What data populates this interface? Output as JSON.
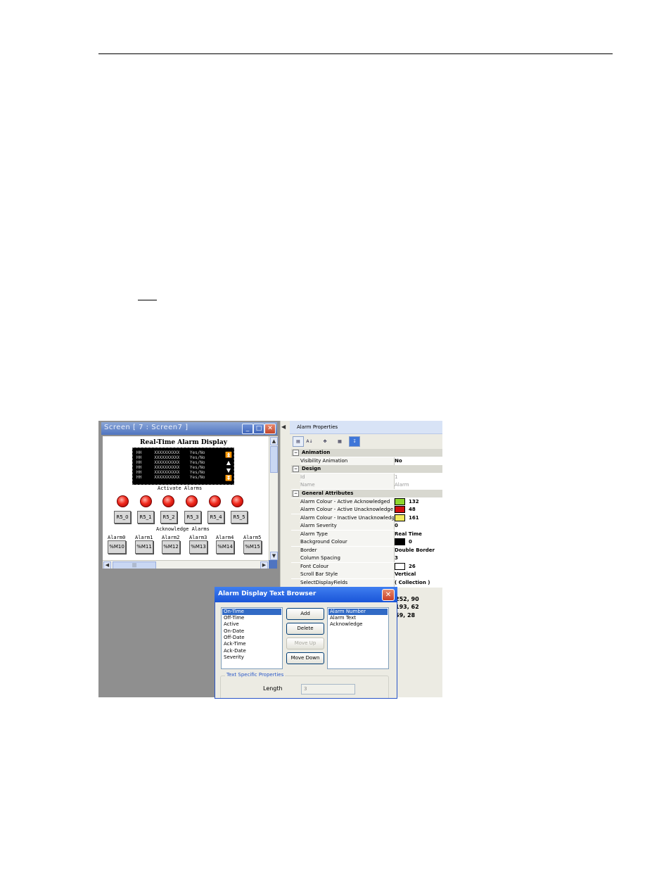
{
  "screen_window": {
    "title": "Screen  [ 7  :  Screen7 ]",
    "minimize": "_",
    "maximize": "□",
    "close": "✕",
    "display_title": "Real-Time Alarm Display",
    "alarm_rows": [
      "HH     XXXXXXXXXX    Yes/No",
      "HH     XXXXXXXXXX    Yes/No",
      "HH     XXXXXXXXXX    Yes/No",
      "HH     XXXXXXXXXX    Yes/No",
      "HH     XXXXXXXXXX    Yes/No",
      "HH     XXXXXXXXXX    Yes/No"
    ],
    "activate_label": "Activate Alarms",
    "reset_buttons": [
      "R5_0",
      "R5_1",
      "R5_2",
      "R5_3",
      "R5_4",
      "R5_5"
    ],
    "acknowledge_label": "Acknowledge Alarms",
    "alarm_labels": [
      "Alarm0",
      "Alarm1",
      "Alarm2",
      "Alarm3",
      "Alarm4",
      "Alarm5"
    ],
    "memory_buttons": [
      "%M10",
      "%M11",
      "%M12",
      "%M13",
      "%M14",
      "%M15"
    ]
  },
  "properties": {
    "title": "Alarm Properties",
    "animation": {
      "category": "Animation",
      "visibility_name": "Visibility Animation",
      "visibility_value": "No"
    },
    "design": {
      "category": "Design",
      "id_name": "Id",
      "id_value": "1",
      "name_name": "Name",
      "name_value": "Alarm"
    },
    "general": {
      "category": "General Attributes",
      "ack_name": "Alarm Colour - Active Acknowledged",
      "ack_value": "132",
      "ack_color": "#8fd62e",
      "unack_name": "Alarm Colour - Active Unacknowledge",
      "unack_value": "48",
      "unack_color": "#d01010",
      "inactive_name": "Alarm Colour - Inactive Unacknowledg",
      "inactive_value": "161",
      "inactive_color": "#f2ea5c",
      "severity_name": "Alarm Severity",
      "severity_value": "0",
      "type_name": "Alarm Type",
      "type_value": "Real Time",
      "bg_name": "Background Colour",
      "bg_value": "0",
      "bg_color": "#000000",
      "border_name": "Border",
      "border_value": "Double Border",
      "spacing_name": "Column Spacing",
      "spacing_value": "3",
      "font_name": "Font Colour",
      "font_value": "26",
      "font_color": "#ffffff",
      "scroll_name": "Scroll Bar Style",
      "scroll_value": "Vertical",
      "fields_name": "SelectDisplayFields",
      "fields_value": "( Collection )"
    },
    "extra_values": [
      "252, 90",
      "193, 62",
      "59, 28"
    ]
  },
  "dialog": {
    "title": "Alarm Display Text Browser",
    "close": "✕",
    "available": [
      "On-Time",
      "Off-Time",
      "Active",
      "On-Date",
      "Off-Date",
      "Ack-Time",
      "Ack-Date",
      "Severity"
    ],
    "selected": [
      "Alarm Number",
      "Alarm Text",
      "Acknowledge"
    ],
    "add": "Add",
    "delete": "Delete",
    "move_up": "Move Up",
    "move_down": "Move Down",
    "group_label": "Text Specific Properties",
    "length_label": "Length",
    "length_value": "3"
  }
}
